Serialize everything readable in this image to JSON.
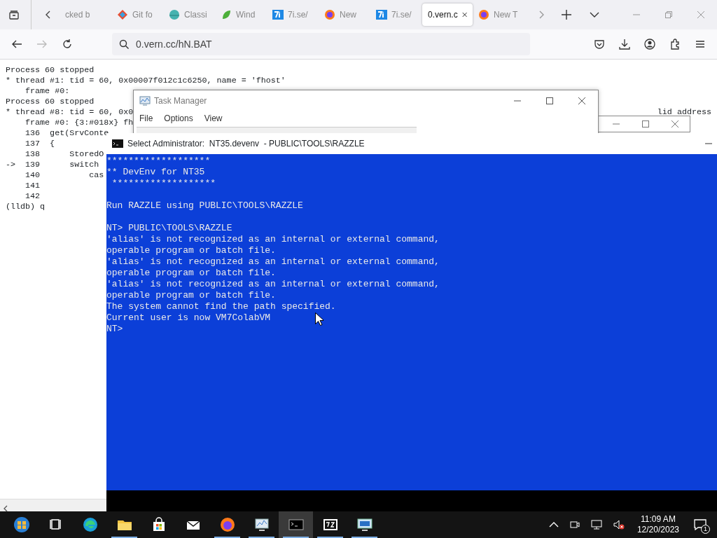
{
  "browser": {
    "tabs": [
      {
        "label": "cked b",
        "kind": "none",
        "selected": false
      },
      {
        "label": "Git fo",
        "kind": "git",
        "selected": false
      },
      {
        "label": "Classi",
        "kind": "globe",
        "selected": false
      },
      {
        "label": "Wind",
        "kind": "leaf",
        "selected": false
      },
      {
        "label": "7i.se/",
        "kind": "seven",
        "selected": false
      },
      {
        "label": "New",
        "kind": "firefox",
        "selected": false
      },
      {
        "label": "7i.se/",
        "kind": "seven",
        "selected": false
      },
      {
        "label": "0.vern.c",
        "kind": "none",
        "selected": true
      },
      {
        "label": "New T",
        "kind": "firefox",
        "selected": false
      }
    ],
    "address": "0.vern.cc/hN.BAT"
  },
  "lldb": {
    "lines": [
      {
        "text": "Process 60 stopped"
      },
      {
        "text": "* thread #1: tid = 60, 0x00007f012c1c6250, name = 'fhost'"
      },
      {
        "text": "    frame #0:"
      },
      {
        "text": "Process 60 stopped"
      },
      {
        "text": "* thread #8: tid = 60, 0x0",
        "right": "lid address"
      },
      {
        "text": "    frame #0: {3:#018x} fh"
      },
      {
        "text": "    136  get(SrvConte"
      },
      {
        "text": "    137  {"
      },
      {
        "text": "    138      StoredO"
      },
      {
        "text": "->  139      switch"
      },
      {
        "text": "    140          cas"
      },
      {
        "text": "    141"
      },
      {
        "text": "    142"
      },
      {
        "text": "(lldb) q"
      }
    ]
  },
  "task_manager": {
    "title": "Task Manager",
    "menu": [
      "File",
      "Options",
      "View"
    ]
  },
  "console": {
    "title": "Select Administrator:  NT35.devenv  - PUBLIC\\TOOLS\\RAZZLE",
    "blocks": [
      [
        "*******************",
        "** DevEnv for NT35",
        " *******************"
      ],
      [
        "Run RAZZLE using PUBLIC\\TOOLS\\RAZZLE"
      ],
      [
        "NT> PUBLIC\\TOOLS\\RAZZLE",
        "'alias' is not recognized as an internal or external command,",
        "operable program or batch file.",
        "'alias' is not recognized as an internal or external command,",
        "operable program or batch file.",
        "'alias' is not recognized as an internal or external command,",
        "operable program or batch file.",
        "The system cannot find the path specified.",
        "Current user is now VM7ColabVM",
        "NT>"
      ]
    ]
  },
  "taskbar": {
    "apps": [
      {
        "kind": "start",
        "running": false,
        "selected": false
      },
      {
        "kind": "taskview",
        "running": false,
        "selected": false
      },
      {
        "kind": "edge",
        "running": false,
        "selected": false
      },
      {
        "kind": "explorer",
        "running": true,
        "selected": false
      },
      {
        "kind": "store",
        "running": false,
        "selected": false
      },
      {
        "kind": "mail",
        "running": false,
        "selected": false
      },
      {
        "kind": "firefox",
        "running": true,
        "selected": false
      },
      {
        "kind": "taskmgr",
        "running": true,
        "selected": false
      },
      {
        "kind": "cmd",
        "running": true,
        "selected": true
      },
      {
        "kind": "sevenzip",
        "running": true,
        "selected": false
      },
      {
        "kind": "rdp",
        "running": true,
        "selected": false
      }
    ],
    "clock": {
      "time": "11:09 AM",
      "date": "12/20/2023"
    },
    "notification_count": "1"
  }
}
